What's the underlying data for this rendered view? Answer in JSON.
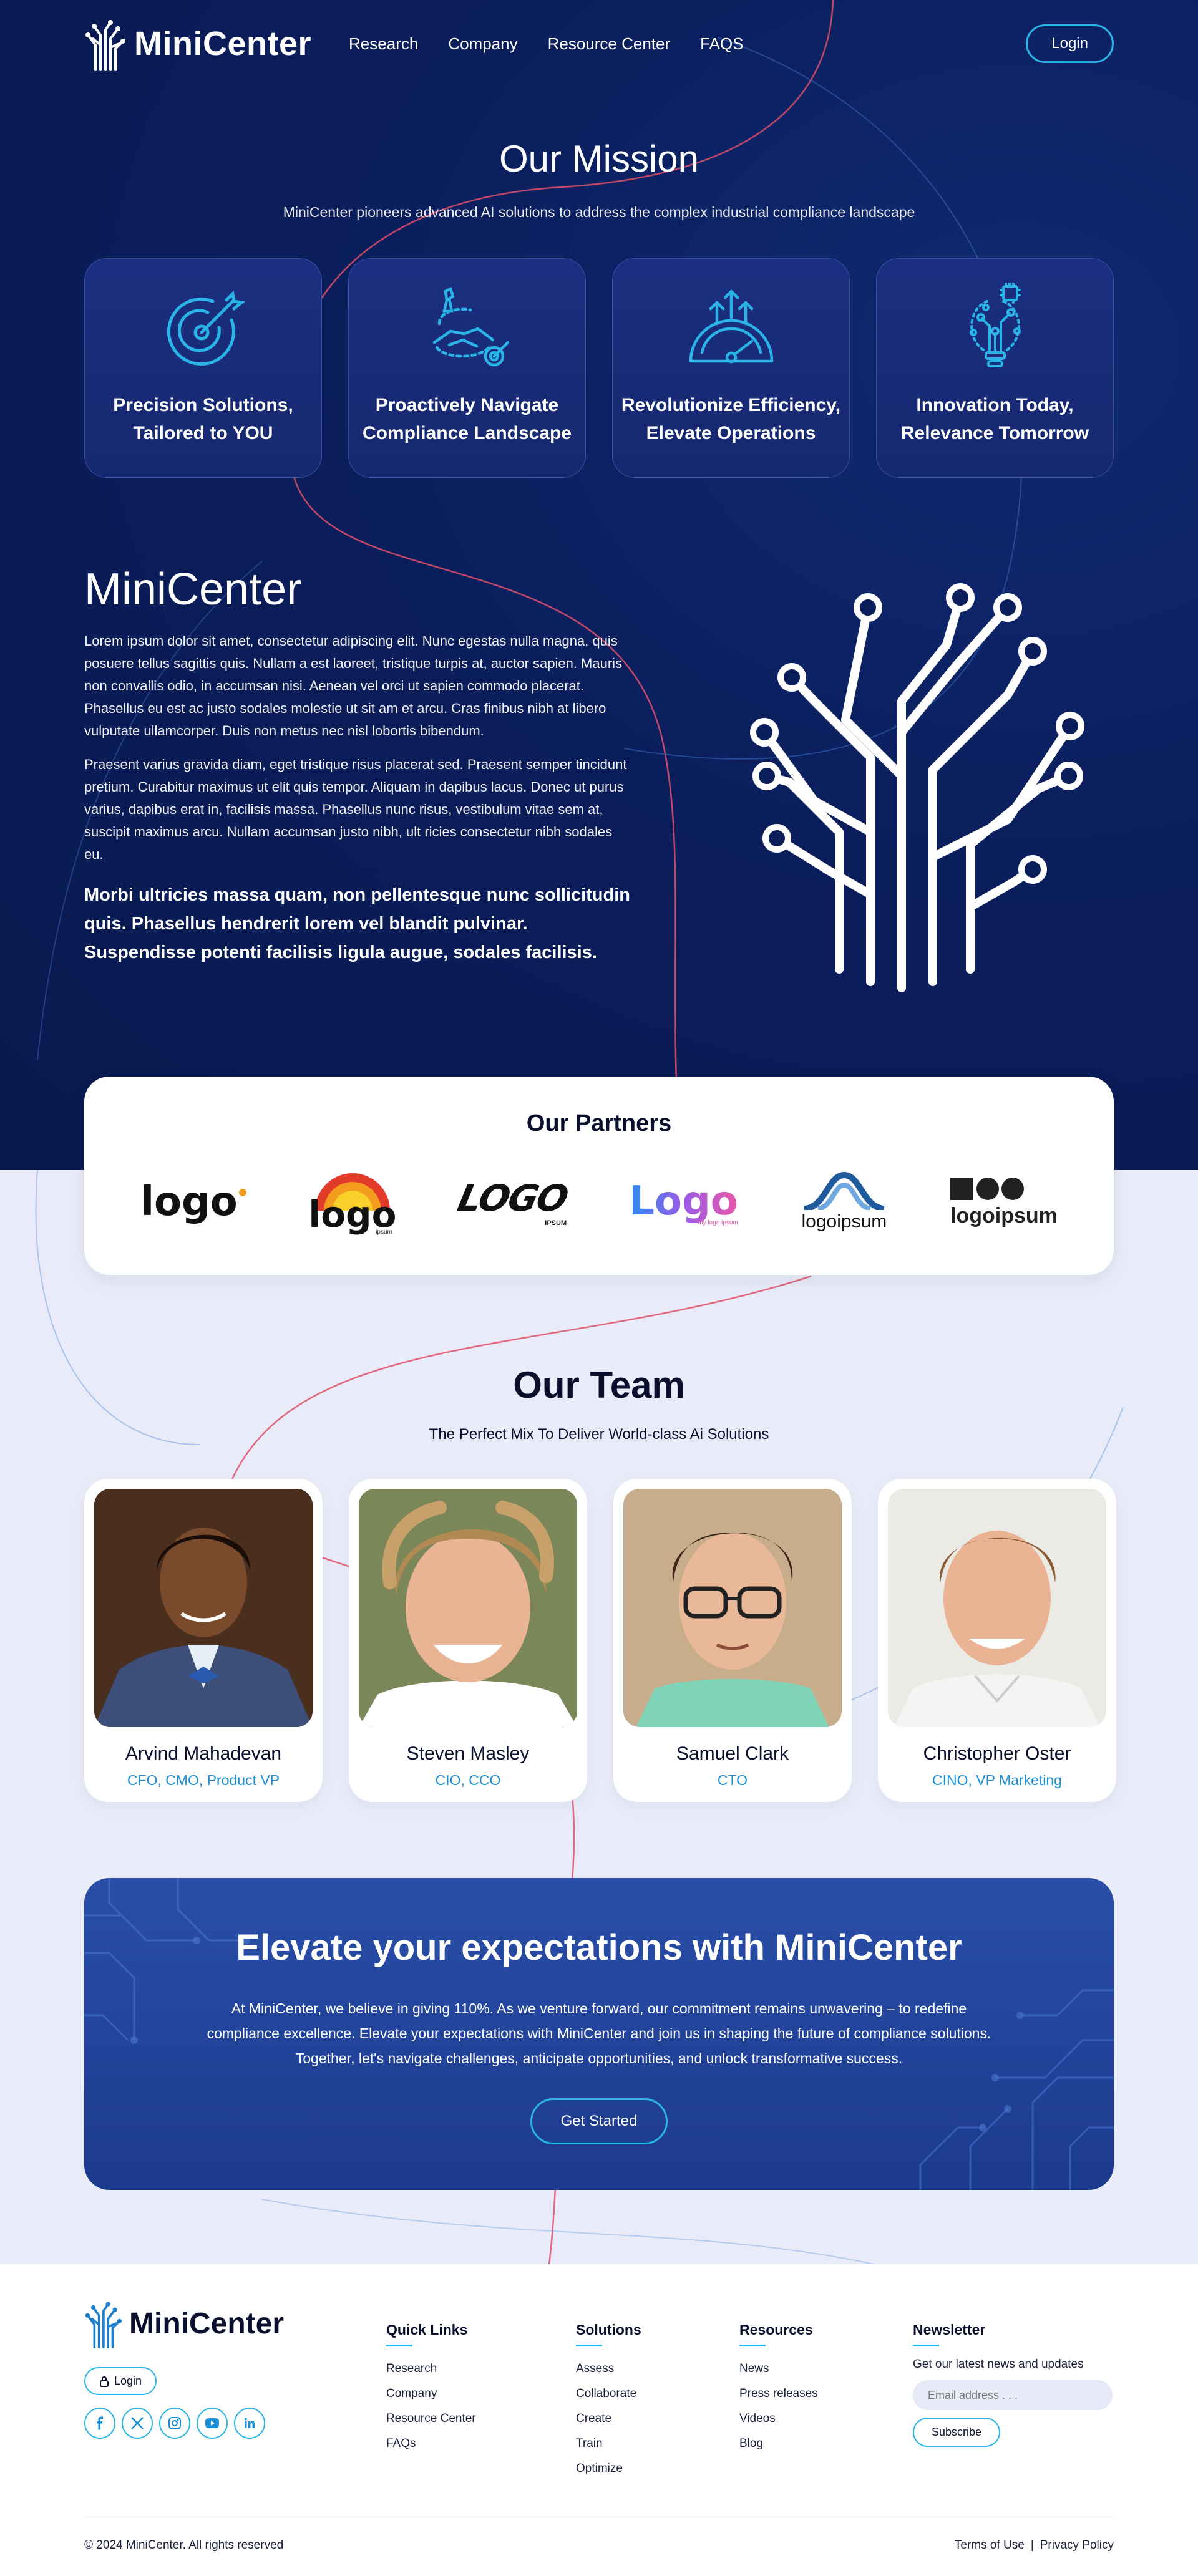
{
  "nav": {
    "brand": "MiniCenter",
    "links": [
      "Research",
      "Company",
      "Resource Center",
      "FAQS"
    ],
    "login": "Login"
  },
  "mission": {
    "title": "Our Mission",
    "subtitle": "MiniCenter pioneers advanced AI solutions to address the complex industrial compliance landscape",
    "cards": [
      {
        "icon": "target-arrow-icon",
        "line1": "Precision Solutions,",
        "line2": "Tailored to YOU"
      },
      {
        "icon": "handshake-chess-icon",
        "line1": "Proactively Navigate",
        "line2": "Compliance Landscape"
      },
      {
        "icon": "speedometer-icon",
        "line1": "Revolutionize Efficiency,",
        "line2": "Elevate Operations"
      },
      {
        "icon": "lightbulb-circuit-icon",
        "line1": "Innovation Today,",
        "line2": "Relevance Tomorrow"
      }
    ]
  },
  "about": {
    "title": "MiniCenter",
    "p1": "Lorem ipsum dolor sit amet, consectetur adipiscing elit. Nunc egestas nulla magna, quis posuere tellus sagittis quis. Nullam a est laoreet, tristique turpis at, auctor sapien. Mauris non convallis odio, in accumsan nisi. Aenean vel orci ut sapien commodo placerat. Phasellus eu est ac justo sodales molestie ut sit am et arcu. Cras finibus nibh at libero vulputate ullamcorper. Duis non metus nec nisl lobortis bibendum.",
    "p2": "Praesent varius gravida diam, eget tristique risus placerat sed. Praesent semper tincidunt pretium. Curabitur maximus ut elit quis tempor. Aliquam in dapibus lacus. Donec ut purus varius, dapibus erat in, facilisis massa. Phasellus nunc risus, vestibulum vitae sem at, suscipit maximus arcu. Nullam accumsan justo nibh, ult ricies consectetur nibh sodales eu.",
    "bold": "Morbi ultricies massa quam, non pellentesque nunc sollicitudin quis. Phasellus hendrerit lorem vel blandit pulvinar. Suspendisse potenti facilisis ligula augue, sodales facilisis."
  },
  "partners": {
    "title": "Our Partners",
    "logos": [
      {
        "text": "logo"
      },
      {
        "text": "logo",
        "sub": "ipsum"
      },
      {
        "text": "LOGO",
        "sub": "IPSUM"
      },
      {
        "text": "Logo",
        "sub": "my logo ipsum"
      },
      {
        "text": "logoipsum"
      },
      {
        "text": "logoipsum"
      }
    ]
  },
  "team": {
    "title": "Our Team",
    "subtitle": "The Perfect Mix To Deliver World-class Ai Solutions",
    "members": [
      {
        "name": "Arvind Mahadevan",
        "role": "CFO, CMO, Product VP"
      },
      {
        "name": "Steven Masley",
        "role": "CIO, CCO"
      },
      {
        "name": "Samuel Clark",
        "role": "CTO"
      },
      {
        "name": "Christopher Oster",
        "role": "CINO, VP Marketing"
      }
    ]
  },
  "cta": {
    "title": "Elevate your expectations with MiniCenter",
    "text": "At MiniCenter, we believe in giving 110%. As we venture forward, our commitment remains unwavering – to redefine compliance excellence. Elevate your expectations with MiniCenter and join us in shaping the future of compliance solutions. Together, let's navigate challenges, anticipate opportunities, and unlock transformative success.",
    "button": "Get Started"
  },
  "footer": {
    "brand": "MiniCenter",
    "login": "Login",
    "socials": [
      "facebook-icon",
      "x-icon",
      "instagram-icon",
      "youtube-icon",
      "linkedin-icon"
    ],
    "quick_links": {
      "title": "Quick Links",
      "items": [
        "Research",
        "Company",
        "Resource Center",
        "FAQs"
      ]
    },
    "solutions": {
      "title": "Solutions",
      "items": [
        "Assess",
        "Collaborate",
        "Create",
        "Train",
        "Optimize"
      ]
    },
    "resources": {
      "title": "Resources",
      "items": [
        "News",
        "Press releases",
        "Videos",
        "Blog"
      ]
    },
    "newsletter": {
      "title": "Newsletter",
      "text": "Get our latest news and updates",
      "placeholder": "Email address . . .",
      "button": "Subscribe"
    },
    "copyright": "© 2024 MiniCenter. All rights reserved",
    "terms": "Terms of Use",
    "separator": "|",
    "privacy": "Privacy Policy"
  },
  "colors": {
    "navy": "#0b1e5c",
    "accent": "#2ab4e8",
    "role_blue": "#1b8fd6",
    "line_red": "#e0506a",
    "light_bg": "#e9ecf8"
  }
}
